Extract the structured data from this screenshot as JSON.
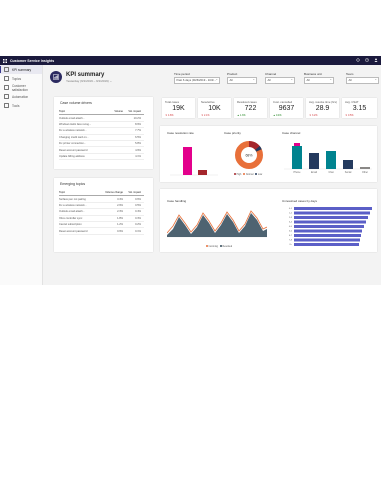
{
  "app": {
    "title": "Customer Service Insights"
  },
  "sidebar": {
    "items": [
      {
        "label": "KPI summary",
        "icon": "chart-icon",
        "active": true
      },
      {
        "label": "Topics",
        "icon": "list-icon"
      },
      {
        "label": "Customer satisfaction",
        "icon": "smile-icon"
      },
      {
        "label": "Automation",
        "icon": "bot-icon"
      },
      {
        "label": "Tools",
        "icon": "tools-icon"
      }
    ]
  },
  "header": {
    "title": "KPI summary",
    "subtitle": "Yesterday (9/1/2019 – 9/1/2019) ⌄"
  },
  "filters": [
    {
      "label": "Time period",
      "value": "Past 6 days (9/26/2019 - 10/2/..."
    },
    {
      "label": "Product",
      "value": "All"
    },
    {
      "label": "Channel",
      "value": "All"
    },
    {
      "label": "Business unit",
      "value": "All"
    },
    {
      "label": "Team",
      "value": "All"
    }
  ],
  "topics_card": {
    "title": "Case volume drivers",
    "columns": [
      "Topic",
      "Volume",
      "Vol. impact"
    ],
    "rows": [
      {
        "topic": "Outlook email attach...",
        "volume": "",
        "impact": "10.2%"
      },
      {
        "topic": "Windows Hello face recog...",
        "volume": "",
        "impact": "8.9%"
      },
      {
        "topic": "Fix a wireless network...",
        "volume": "",
        "impact": "7.7%"
      },
      {
        "topic": "Changing credit card on...",
        "volume": "",
        "impact": "6.5%"
      },
      {
        "topic": "Fix printer connection...",
        "volume": "",
        "impact": "5.8%"
      },
      {
        "topic": "Reset account password",
        "volume": "",
        "impact": "4.9%"
      },
      {
        "topic": "Update billing address",
        "volume": "",
        "impact": "4.1%"
      }
    ]
  },
  "emerging_card": {
    "title": "Emerging topics",
    "columns": [
      "Topic",
      "Volume change",
      "Vol. impact"
    ],
    "rows": [
      {
        "topic": "Surface pen not pairing",
        "change": "3.4%",
        "impact": "0.6%"
      },
      {
        "topic": "Fix a wireless network...",
        "change": "2.9%",
        "impact": "0.5%"
      },
      {
        "topic": "Outlook email attach...",
        "change": "2.3%",
        "impact": "0.4%"
      },
      {
        "topic": "Xbox controller sync",
        "change": "1.8%",
        "impact": "0.3%"
      },
      {
        "topic": "Cancel subscription",
        "change": "1.2%",
        "impact": "0.2%"
      },
      {
        "topic": "Reset account password",
        "change": "0.9%",
        "impact": "0.1%"
      }
    ]
  },
  "kpis": [
    {
      "label": "Total cases",
      "value": "19K",
      "sub": "▼ 4.8%",
      "dir": "down"
    },
    {
      "label": "New/active",
      "value": "10K",
      "sub": "▼ 2.1%",
      "dir": "down"
    },
    {
      "label": "Resolved cases",
      "value": "722",
      "sub": "▲ 1.3%",
      "dir": "up"
    },
    {
      "label": "Cust. cancelled",
      "value": "9637",
      "sub": "▲ 0.4%",
      "dir": "up"
    },
    {
      "label": "Avg. resolve time (hrs)",
      "value": "28.9",
      "sub": "▼ 3.2%",
      "dir": "down"
    },
    {
      "label": "Avg. CSAT",
      "value": "3.15",
      "sub": "▼ 0.5%",
      "dir": "down"
    }
  ],
  "charts_card": {
    "resolution_title": "Case resolution rate",
    "priority_title": "Case priority",
    "channel_title": "Case channel",
    "priority_center": "68%",
    "priority_legend": [
      "High",
      "Normal",
      "Low"
    ],
    "channel_categories": [
      "Phone",
      "Email",
      "Chat",
      "Social",
      "Other"
    ]
  },
  "bottom_card": {
    "trend_title": "Case handling",
    "trend_legend": [
      "Incoming",
      "Resolved"
    ],
    "duration_title": "Unresolved cases by days",
    "duration_rows": [
      "0-1",
      "1-2",
      "2-3",
      "3-4",
      "4-5",
      "5-6",
      "6-7",
      "7-8",
      "8+"
    ]
  },
  "colors": {
    "brand": "#1b1a3d",
    "magenta": "#e3008c",
    "dark_red": "#a4262c",
    "orange": "#e8703a",
    "teal": "#00838f",
    "navy": "#243a5e",
    "purple": "#5b5fc7",
    "gray": "#8a8886"
  }
}
